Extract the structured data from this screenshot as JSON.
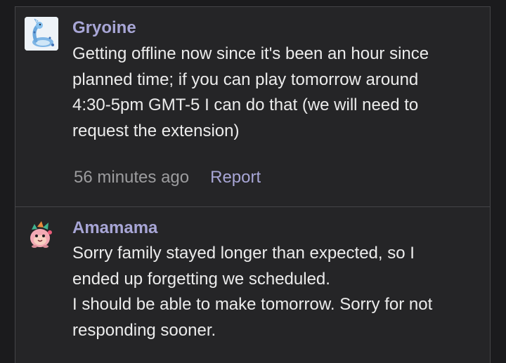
{
  "comments": [
    {
      "username": "Gryoine",
      "avatar_icon": "dragonair-sprite-icon",
      "lines": [
        "Getting offline now since it's been an hour since",
        "planned time; if you can play tomorrow around",
        "4:30-5pm GMT-5 I can do that (we will need to",
        "request the extension)"
      ],
      "timestamp": "56 minutes ago",
      "report_label": "Report"
    },
    {
      "username": "Amamama",
      "avatar_icon": "pink-creature-sprite-icon",
      "lines": [
        "Sorry family stayed longer than expected, so I",
        "ended up forgetting we scheduled.",
        "I should be able to make tomorrow. Sorry for not",
        "responding sooner."
      ]
    }
  ],
  "colors": {
    "background": "#1b1b1d",
    "card": "#252527",
    "border": "#444447",
    "username": "#a8a6d6",
    "text": "#ececec",
    "muted": "#9c9c9e"
  }
}
